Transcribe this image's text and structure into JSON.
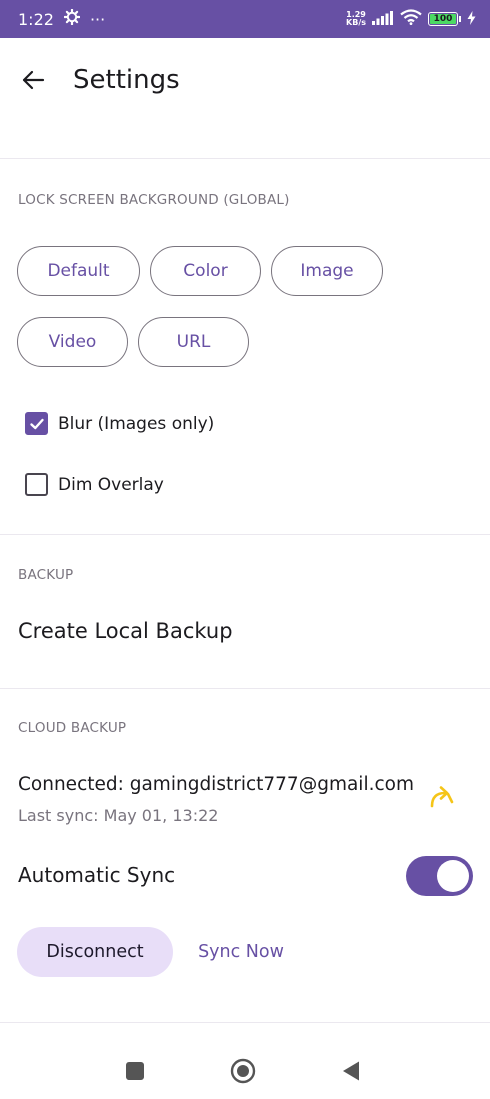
{
  "status_bar": {
    "time": "1:22",
    "more": "···",
    "net_speed_value": "1.29",
    "net_speed_unit": "KB/s",
    "battery_level": "100",
    "battery_fraction": 1.0
  },
  "toolbar": {
    "title": "Settings",
    "back_icon": "arrow-back-icon"
  },
  "lock_screen": {
    "header": "LOCK SCREEN BACKGROUND (GLOBAL)",
    "options": [
      "Default",
      "Color",
      "Image",
      "Video",
      "URL"
    ],
    "blur_label": "Blur (Images only)",
    "blur_checked": true,
    "dim_label": "Dim Overlay",
    "dim_checked": false
  },
  "backup": {
    "header": "BACKUP",
    "create_local": "Create Local Backup"
  },
  "cloud_backup": {
    "header": "CLOUD BACKUP",
    "connected": "Connected: gamingdistrict777@gmail.com",
    "last_sync": "Last sync: May 01, 13:22",
    "auto_sync_label": "Automatic Sync",
    "auto_sync_on": true,
    "disconnect_label": "Disconnect",
    "sync_now_label": "Sync Now"
  },
  "colors": {
    "primary": "#6750a4",
    "tonal": "#e8def8",
    "share_icon": "#f5c518"
  }
}
